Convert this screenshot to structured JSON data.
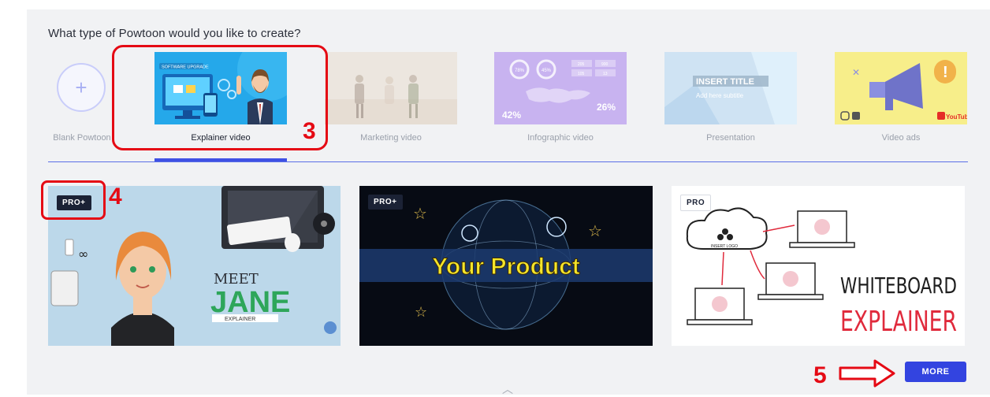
{
  "question": "What type of Powtoon would you like to create?",
  "types": [
    {
      "label": "Blank Powtoon"
    },
    {
      "label": "Explainer video"
    },
    {
      "label": "Marketing video"
    },
    {
      "label": "Infographic video"
    },
    {
      "label": "Presentation"
    },
    {
      "label": "Video ads"
    }
  ],
  "active_type": "Explainer video",
  "thumb_texts": {
    "explainer_banner": "SOFTWARE UPGRADE",
    "infographic_p1": "78%",
    "infographic_p2": "45%",
    "infographic_s1": "205",
    "infographic_s2": "900",
    "infographic_s3": "105",
    "infographic_s4": "13",
    "infographic_pct_left": "42%",
    "infographic_pct_right": "26%",
    "presentation_title": "INSERT TITLE",
    "presentation_subtitle": "Add here subtitle",
    "videoads_youtube": "YouTube"
  },
  "templates": [
    {
      "badge": "PRO+",
      "line1": "MEET",
      "line2": "JANE",
      "line3": "EXPLAINER"
    },
    {
      "badge": "PRO+",
      "headline": "Your Product"
    },
    {
      "badge": "PRO",
      "logo_text": "INSERT LOGO",
      "line1": "WHITEBOARD",
      "line2": "EXPLAINER"
    }
  ],
  "more_label": "MORE",
  "annotations": {
    "a3": "3",
    "a4": "4",
    "a5": "5"
  },
  "colors": {
    "accent": "#3f51e4",
    "annotation": "#e50a14"
  }
}
